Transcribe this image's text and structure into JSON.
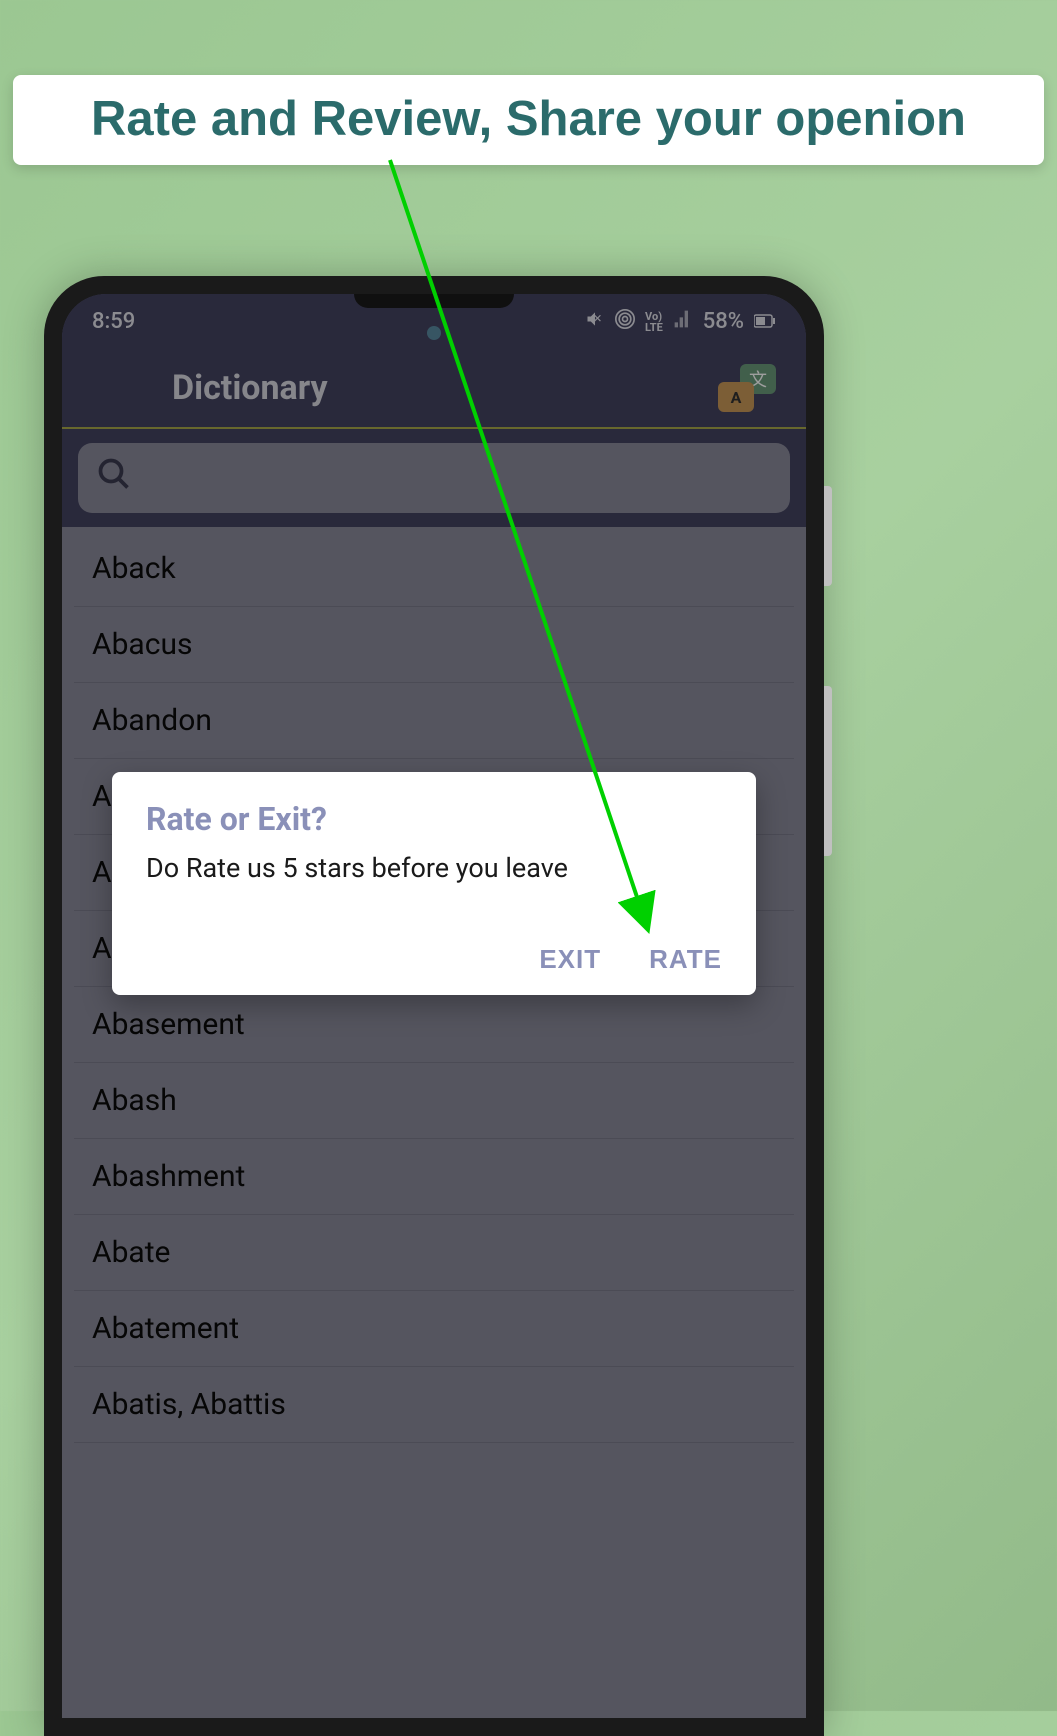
{
  "banner": {
    "text": "Rate and Review, Share your openion"
  },
  "status_bar": {
    "time": "8:59",
    "battery_text": "58%"
  },
  "app": {
    "title": "Dictionary"
  },
  "search": {
    "placeholder": ""
  },
  "words": [
    "Aback",
    "Abacus",
    "Abandon",
    "A",
    "A",
    "A",
    "Abasement",
    "Abash",
    "Abashment",
    "Abate",
    "Abatement",
    "Abatis, Abattis"
  ],
  "dialog": {
    "title": "Rate or Exit?",
    "message": "Do Rate us 5 stars before you leave",
    "exit_label": "EXIT",
    "rate_label": "RATE"
  }
}
